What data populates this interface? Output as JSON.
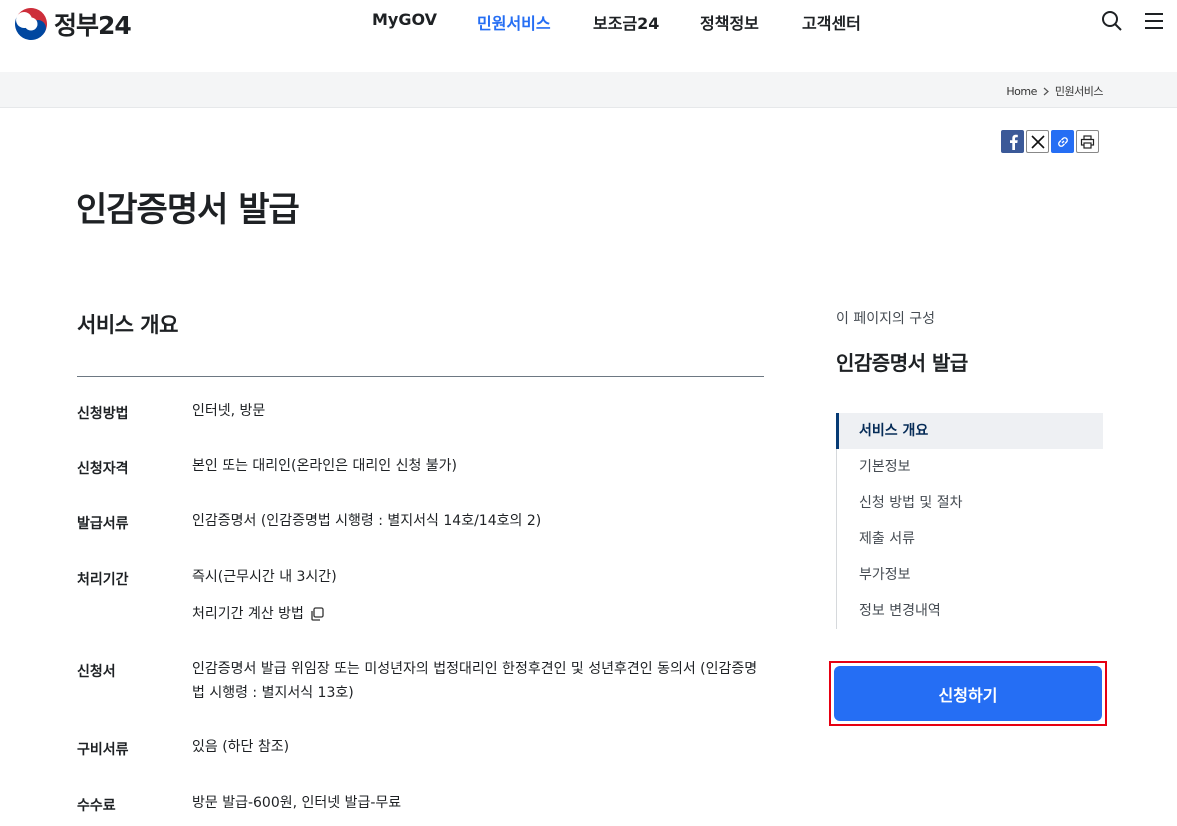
{
  "header": {
    "logo_text": "정부24",
    "nav": [
      {
        "label": "MyGOV",
        "active": false
      },
      {
        "label": "민원서비스",
        "active": true
      },
      {
        "label": "보조금24",
        "active": false
      },
      {
        "label": "정책정보",
        "active": false
      },
      {
        "label": "고객센터",
        "active": false
      }
    ],
    "icons": [
      "search-icon",
      "menu-icon"
    ]
  },
  "breadcrumb": {
    "home": "Home",
    "current": "민원서비스"
  },
  "share_icons": [
    "facebook-icon",
    "x-icon",
    "link-icon",
    "print-icon"
  ],
  "page_title": "인감증명서 발급",
  "overview": {
    "title": "서비스 개요",
    "rows": [
      {
        "label": "신청방법",
        "value": "인터넷, 방문"
      },
      {
        "label": "신청자격",
        "value": "본인 또는 대리인(온라인은 대리인 신청 불가)"
      },
      {
        "label": "발급서류",
        "value": "인감증명서 (인감증명법 시행령 : 별지서식 14호/14호의 2)"
      },
      {
        "label": "처리기간",
        "value": "즉시(근무시간 내 3시간)",
        "sub_link": "처리기간 계산 방법"
      },
      {
        "label": "신청서",
        "value": "인감증명서 발급 위임장 또는 미성년자의 법정대리인 한정후견인 및 성년후견인 동의서 (인감증명법 시행령 : 별지서식 13호)"
      },
      {
        "label": "구비서류",
        "value": "있음 (하단 참조)"
      },
      {
        "label": "수수료",
        "value": "방문 발급-600원, 인터넷 발급-무료"
      }
    ]
  },
  "aside": {
    "caption": "이 페이지의 구성",
    "title": "인감증명서 발급",
    "toc": [
      {
        "label": "서비스 개요",
        "active": true
      },
      {
        "label": "기본정보",
        "active": false
      },
      {
        "label": "신청 방법 및 절차",
        "active": false
      },
      {
        "label": "제출 서류",
        "active": false
      },
      {
        "label": "부가정보",
        "active": false
      },
      {
        "label": "정보 변경내역",
        "active": false
      }
    ],
    "apply_label": "신청하기"
  },
  "colors": {
    "accent": "#256ef4",
    "highlight_border": "#e60012",
    "toc_active": "#063a74"
  }
}
